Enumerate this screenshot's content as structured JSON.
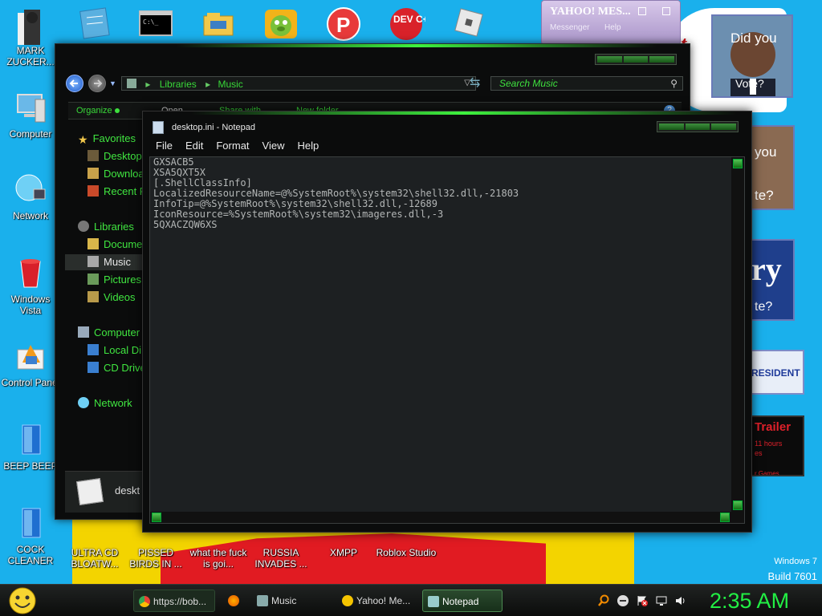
{
  "desktop": {
    "icons_left": [
      {
        "label": "MARK ZUCKER...",
        "icon": "person-icon"
      },
      {
        "label": "Computer",
        "icon": "computer-icon"
      },
      {
        "label": "Network",
        "icon": "network-globe-icon"
      },
      {
        "label": "Windows Vista",
        "icon": "recycle-bin-icon"
      },
      {
        "label": "Control Panel",
        "icon": "control-panel-icon"
      },
      {
        "label": "BEEP BEEP",
        "icon": "blue-file-icon"
      },
      {
        "label": "COCK CLEANER",
        "icon": "blue-file-icon"
      }
    ],
    "icons_bottom": [
      {
        "label": "ULTRA CD BLOATW...",
        "icon": "cd-icon"
      },
      {
        "label": "PISSED BIRDS IN ...",
        "icon": "bird-icon"
      },
      {
        "label": "what the fuck is goi...",
        "icon": "app-icon"
      },
      {
        "label": "RUSSIA INVADES ...",
        "icon": "app-icon"
      },
      {
        "label": "XMPP",
        "icon": "app-icon"
      },
      {
        "label": "Roblox Studio",
        "icon": "roblox-icon"
      }
    ],
    "top_icons": [
      "notes-icon",
      "cmd-icon",
      "folder-icon",
      "pig-icon",
      "p-logo-icon",
      "devcpp-icon",
      "roblox-icon"
    ],
    "top_icon_labels": {
      "devcpp": "DEV C++"
    },
    "watermark": {
      "line1": "Windows 7",
      "line2": "Build 7601"
    },
    "ads": {
      "yahoo_title": "YAHOO! MES...",
      "yahoo_sub1": "Messenger",
      "yahoo_sub2": "Help",
      "obama1_line1": "Did you",
      "obama1_line2": "Vote?",
      "obama2_line1": "you",
      "obama2_line2": "te?",
      "ry_text": "ry",
      "ry_sub": "te?",
      "president_text": "RESIDENT",
      "trailer_title": "Trailer",
      "trailer_line1": "11 hours",
      "trailer_line2": "es",
      "trailer_line3": "r Games"
    }
  },
  "explorer": {
    "address": {
      "root": "Libraries",
      "folder": "Music"
    },
    "search_placeholder": "Search Music",
    "toolbar": {
      "organize": "Organize",
      "open": "Open",
      "share": "Share with",
      "new_folder": "New folder"
    },
    "nav": {
      "favorites": "Favorites",
      "desktop": "Desktop",
      "downloads": "Downloa",
      "recent": "Recent P",
      "libraries": "Libraries",
      "documents": "Docume",
      "music": "Music",
      "pictures": "Pictures",
      "videos": "Videos",
      "computer": "Computer",
      "local_disk": "Local Di",
      "cd_drive": "CD Drive",
      "network": "Network"
    },
    "details_filename": "deskt"
  },
  "notepad": {
    "title": "desktop.ini - Notepad",
    "menu": [
      "File",
      "Edit",
      "Format",
      "View",
      "Help"
    ],
    "content": "GXSACB5\nXSA5QXT5X\n[.ShellClassInfo]\nLocalizedResourceName=@%SystemRoot%\\system32\\shell32.dll,-21803\nInfoTip=@%SystemRoot%\\system32\\shell32.dll,-12689\nIconResource=%SystemRoot%\\system32\\imageres.dll,-3\n5QXACZQW6XS"
  },
  "taskbar": {
    "items": [
      {
        "label": "https://bob...",
        "icon": "chrome-icon",
        "color": "#e94235"
      },
      {
        "label": "",
        "icon": "firefox-icon",
        "color": "#f57c00"
      },
      {
        "label": "Music",
        "icon": "explorer-icon",
        "color": "#8aa"
      },
      {
        "label": "Yahoo! Me...",
        "icon": "yahoo-smiley-icon",
        "color": "#f5c400"
      },
      {
        "label": "Notepad",
        "icon": "notepad-icon",
        "color": "#9cc"
      }
    ],
    "clock": "2:35 AM"
  },
  "colors": {
    "accent_green": "#3ee03e",
    "clock_green": "#22ee44",
    "desktop_blue": "#1ab0ec"
  }
}
